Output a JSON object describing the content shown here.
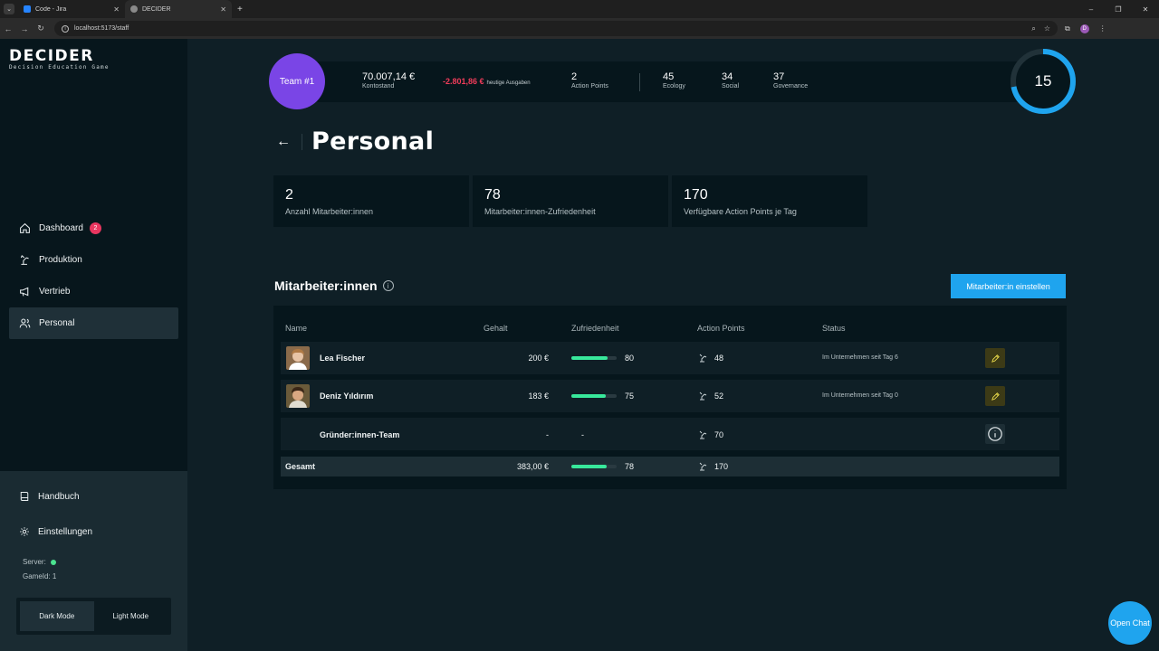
{
  "browser": {
    "tabs": [
      {
        "label": "Code - Jira",
        "active": false
      },
      {
        "label": "DECIDER",
        "active": true
      }
    ],
    "url": "localhost:5173/staff"
  },
  "brand": {
    "title": "DECIDER",
    "subtitle": "Decision Education Game"
  },
  "sidebar": {
    "items": [
      {
        "label": "Dashboard",
        "icon": "home-icon",
        "badge": "2",
        "active": false
      },
      {
        "label": "Produktion",
        "icon": "robot-arm-icon",
        "active": false
      },
      {
        "label": "Vertrieb",
        "icon": "megaphone-icon",
        "active": false
      },
      {
        "label": "Personal",
        "icon": "users-icon",
        "active": true
      }
    ],
    "handbook": "Handbuch",
    "settings": "Einstellungen",
    "server_label": "Server:",
    "gameid_label": "GameId: 1",
    "modes": [
      {
        "label": "Dark Mode",
        "active": true
      },
      {
        "label": "Light Mode",
        "active": false
      }
    ]
  },
  "header": {
    "team": "Team #1",
    "balance": {
      "value": "70.007,14 €",
      "label": "Kontostand"
    },
    "expenses": {
      "value": "-2.801,86 €",
      "label": "heutige Ausgaben"
    },
    "action_points": {
      "value": "2",
      "label": "Action Points"
    },
    "ecology": {
      "value": "45",
      "label": "Ecology"
    },
    "social": {
      "value": "34",
      "label": "Social"
    },
    "governance": {
      "value": "37",
      "label": "Governance"
    },
    "day": "15",
    "day_progress": 0.72
  },
  "page": {
    "title": "Personal"
  },
  "kpis": [
    {
      "value": "2",
      "label": "Anzahl Mitarbeiter:innen"
    },
    {
      "value": "78",
      "label": "Mitarbeiter:innen-Zufriedenheit"
    },
    {
      "value": "170",
      "label": "Verfügbare Action Points je Tag"
    }
  ],
  "section": {
    "title": "Mitarbeiter:innen",
    "hire_label": "Mitarbeiter:in einstellen"
  },
  "table": {
    "columns": [
      "Name",
      "Gehalt",
      "Zufriedenheit",
      "Action Points",
      "Status"
    ],
    "rows": [
      {
        "name": "Lea Fischer",
        "salary": "200 €",
        "satisfaction": "80",
        "satisfaction_pct": 0.8,
        "ap": "48",
        "status": "Im Unternehmen seit Tag 6",
        "action": "edit"
      },
      {
        "name": "Deniz Yıldırım",
        "salary": "183 €",
        "satisfaction": "75",
        "satisfaction_pct": 0.75,
        "ap": "52",
        "status": "Im Unternehmen seit Tag 0",
        "action": "edit"
      },
      {
        "name": "Gründer:innen-Team",
        "salary": "-",
        "satisfaction": "-",
        "ap": "70",
        "status": "",
        "action": "info"
      }
    ],
    "total": {
      "label": "Gesamt",
      "salary": "383,00 €",
      "satisfaction": "78",
      "satisfaction_pct": 0.78,
      "ap": "170"
    }
  },
  "chat": {
    "label": "Open Chat"
  },
  "colors": {
    "accent": "#1fa4ee",
    "team": "#7a45e6",
    "negative": "#f03c5a",
    "positive": "#38e89b"
  }
}
